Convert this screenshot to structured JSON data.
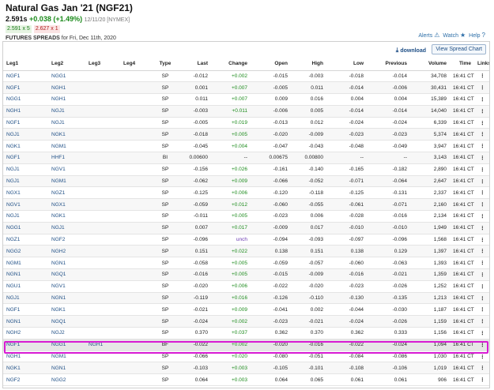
{
  "header": {
    "title": "Natural Gas Jan '21 (NGF21)",
    "last": "2.591s",
    "change": "+0.038 (+1.49%)",
    "timestamp": "12/11/20 [NYMEX]",
    "bid": "2.591 x 5",
    "ask": "2.627 x 1",
    "section": "Futures Spreads",
    "section_date": "for Fri, Dec 11th, 2020",
    "alerts_label": "Alerts",
    "watch_label": "Watch",
    "help_label": "Help"
  },
  "toolbar": {
    "download_label": "download",
    "spread_chart_label": "View Spread Chart"
  },
  "columns": [
    "Leg1",
    "Leg2",
    "Leg3",
    "Leg4",
    "Type",
    "Last",
    "Change",
    "Open",
    "High",
    "Low",
    "Previous",
    "Volume",
    "Time",
    "Links"
  ],
  "rows": [
    {
      "leg1": "NGF1",
      "leg2": "NGG1",
      "leg3": "",
      "leg4": "",
      "type": "SP",
      "last": "-0.012",
      "change": "+0.002",
      "open": "-0.015",
      "high": "-0.003",
      "low": "-0.018",
      "prev": "-0.014",
      "volume": "34,708",
      "time": "16:41 CT",
      "links": "⋮"
    },
    {
      "leg1": "NGF1",
      "leg2": "NGH1",
      "leg3": "",
      "leg4": "",
      "type": "SP",
      "last": "0.001",
      "change": "+0.007",
      "open": "-0.005",
      "high": "0.011",
      "low": "-0.014",
      "prev": "-0.006",
      "volume": "30,431",
      "time": "16:41 CT",
      "links": "⋮"
    },
    {
      "leg1": "NGG1",
      "leg2": "NGH1",
      "leg3": "",
      "leg4": "",
      "type": "SP",
      "last": "0.011",
      "change": "+0.007",
      "open": "0.009",
      "high": "0.016",
      "low": "0.004",
      "prev": "0.004",
      "volume": "15,389",
      "time": "16:41 CT",
      "links": "⋮"
    },
    {
      "leg1": "NGH1",
      "leg2": "NGJ1",
      "leg3": "",
      "leg4": "",
      "type": "SP",
      "last": "-0.003",
      "change": "+0.011",
      "open": "-0.006",
      "high": "0.005",
      "low": "-0.014",
      "prev": "-0.014",
      "volume": "14,040",
      "time": "16:41 CT",
      "links": "⋮"
    },
    {
      "leg1": "NGF1",
      "leg2": "NGJ1",
      "leg3": "",
      "leg4": "",
      "type": "SP",
      "last": "-0.005",
      "change": "+0.019",
      "open": "-0.013",
      "high": "0.012",
      "low": "-0.024",
      "prev": "-0.024",
      "volume": "6,339",
      "time": "16:41 CT",
      "links": "⋮"
    },
    {
      "leg1": "NGJ1",
      "leg2": "NGK1",
      "leg3": "",
      "leg4": "",
      "type": "SP",
      "last": "-0.018",
      "change": "+0.005",
      "open": "-0.020",
      "high": "-0.009",
      "low": "-0.023",
      "prev": "-0.023",
      "volume": "5,374",
      "time": "16:41 CT",
      "links": "⋮"
    },
    {
      "leg1": "NGK1",
      "leg2": "NGM1",
      "leg3": "",
      "leg4": "",
      "type": "SP",
      "last": "-0.045",
      "change": "+0.004",
      "open": "-0.047",
      "high": "-0.043",
      "low": "-0.048",
      "prev": "-0.049",
      "volume": "3,947",
      "time": "16:41 CT",
      "links": "⋮"
    },
    {
      "leg1": "NGF1",
      "leg2": "HHF1",
      "leg3": "",
      "leg4": "",
      "type": "BI",
      "last": "0.00600",
      "change": "--",
      "open": "0.00675",
      "high": "0.00800",
      "low": "--",
      "prev": "--",
      "volume": "3,143",
      "time": "16:41 CT",
      "links": "⋮"
    },
    {
      "leg1": "NGJ1",
      "leg2": "NGV1",
      "leg3": "",
      "leg4": "",
      "type": "SP",
      "last": "-0.156",
      "change": "+0.026",
      "open": "-0.161",
      "high": "-0.140",
      "low": "-0.165",
      "prev": "-0.182",
      "volume": "2,890",
      "time": "16:41 CT",
      "links": "⋮"
    },
    {
      "leg1": "NGJ1",
      "leg2": "NGM1",
      "leg3": "",
      "leg4": "",
      "type": "SP",
      "last": "-0.062",
      "change": "+0.009",
      "open": "-0.066",
      "high": "-0.052",
      "low": "-0.071",
      "prev": "-0.064",
      "volume": "2,647",
      "time": "16:41 CT",
      "links": "⋮"
    },
    {
      "leg1": "NGX1",
      "leg2": "NGZ1",
      "leg3": "",
      "leg4": "",
      "type": "SP",
      "last": "-0.125",
      "change": "+0.006",
      "open": "-0.120",
      "high": "-0.118",
      "low": "-0.125",
      "prev": "-0.131",
      "volume": "2,337",
      "time": "16:41 CT",
      "links": "⋮"
    },
    {
      "leg1": "NGV1",
      "leg2": "NGX1",
      "leg3": "",
      "leg4": "",
      "type": "SP",
      "last": "-0.059",
      "change": "+0.012",
      "open": "-0.060",
      "high": "-0.055",
      "low": "-0.061",
      "prev": "-0.071",
      "volume": "2,160",
      "time": "16:41 CT",
      "links": "⋮"
    },
    {
      "leg1": "NGJ1",
      "leg2": "NGK1",
      "leg3": "",
      "leg4": "",
      "type": "SP",
      "last": "-0.011",
      "change": "+0.005",
      "open": "-0.023",
      "high": "0.006",
      "low": "-0.028",
      "prev": "-0.016",
      "volume": "2,134",
      "time": "16:41 CT",
      "links": "⋮"
    },
    {
      "leg1": "NGG1",
      "leg2": "NGJ1",
      "leg3": "",
      "leg4": "",
      "type": "SP",
      "last": "0.007",
      "change": "+0.017",
      "open": "-0.009",
      "high": "0.017",
      "low": "-0.010",
      "prev": "-0.010",
      "volume": "1,949",
      "time": "16:41 CT",
      "links": "⋮"
    },
    {
      "leg1": "NGZ1",
      "leg2": "NGF2",
      "leg3": "",
      "leg4": "",
      "type": "SP",
      "last": "-0.096",
      "change": "unch",
      "open": "-0.094",
      "high": "-0.093",
      "low": "-0.097",
      "prev": "-0.096",
      "volume": "1,568",
      "time": "16:41 CT",
      "links": "⋮"
    },
    {
      "leg1": "NGG2",
      "leg2": "NGH2",
      "leg3": "",
      "leg4": "",
      "type": "SP",
      "last": "0.151",
      "change": "+0.022",
      "open": "0.138",
      "high": "0.151",
      "low": "0.138",
      "prev": "0.129",
      "volume": "1,397",
      "time": "16:41 CT",
      "links": "⋮"
    },
    {
      "leg1": "NGM1",
      "leg2": "NGN1",
      "leg3": "",
      "leg4": "",
      "type": "SP",
      "last": "-0.058",
      "change": "+0.005",
      "open": "-0.059",
      "high": "-0.057",
      "low": "-0.060",
      "prev": "-0.063",
      "volume": "1,393",
      "time": "16:41 CT",
      "links": "⋮"
    },
    {
      "leg1": "NGN1",
      "leg2": "NGQ1",
      "leg3": "",
      "leg4": "",
      "type": "SP",
      "last": "-0.016",
      "change": "+0.005",
      "open": "-0.015",
      "high": "-0.009",
      "low": "-0.016",
      "prev": "-0.021",
      "volume": "1,359",
      "time": "16:41 CT",
      "links": "⋮"
    },
    {
      "leg1": "NGU1",
      "leg2": "NGV1",
      "leg3": "",
      "leg4": "",
      "type": "SP",
      "last": "-0.020",
      "change": "+0.006",
      "open": "-0.022",
      "high": "-0.020",
      "low": "-0.023",
      "prev": "-0.026",
      "volume": "1,252",
      "time": "16:41 CT",
      "links": "⋮"
    },
    {
      "leg1": "NGJ1",
      "leg2": "NGN1",
      "leg3": "",
      "leg4": "",
      "type": "SP",
      "last": "-0.119",
      "change": "+0.016",
      "open": "-0.126",
      "high": "-0.110",
      "low": "-0.130",
      "prev": "-0.135",
      "volume": "1,213",
      "time": "16:41 CT",
      "links": "⋮"
    },
    {
      "leg1": "NGF1",
      "leg2": "NGK1",
      "leg3": "",
      "leg4": "",
      "type": "SP",
      "last": "-0.021",
      "change": "+0.009",
      "open": "-0.041",
      "high": "0.002",
      "low": "-0.044",
      "prev": "-0.030",
      "volume": "1,187",
      "time": "16:41 CT",
      "links": "⋮"
    },
    {
      "leg1": "NGN1",
      "leg2": "NGQ1",
      "leg3": "",
      "leg4": "",
      "type": "SP",
      "last": "-0.024",
      "change": "+0.002",
      "open": "-0.023",
      "high": "-0.021",
      "low": "-0.024",
      "prev": "-0.026",
      "volume": "1,159",
      "time": "16:41 CT",
      "links": "⋮"
    },
    {
      "leg1": "NGH2",
      "leg2": "NGJ2",
      "leg3": "",
      "leg4": "",
      "type": "SP",
      "last": "0.370",
      "change": "+0.037",
      "open": "0.362",
      "high": "0.370",
      "low": "0.362",
      "prev": "0.333",
      "volume": "1,156",
      "time": "16:41 CT",
      "links": "⋮"
    },
    {
      "leg1": "NGF1",
      "leg2": "NGG1",
      "leg3": "NGH1",
      "leg4": "",
      "type": "BF",
      "last": "-0.022",
      "change": "+0.002",
      "open": "-0.020",
      "high": "-0.016",
      "low": "-0.022",
      "prev": "-0.024",
      "volume": "1,094",
      "time": "16:41 CT",
      "links": "⋮"
    },
    {
      "leg1": "NGH1",
      "leg2": "NGM1",
      "leg3": "",
      "leg4": "",
      "type": "SP",
      "last": "-0.066",
      "change": "+0.020",
      "open": "-0.080",
      "high": "-0.051",
      "low": "-0.084",
      "prev": "-0.086",
      "volume": "1,030",
      "time": "16:41 CT",
      "links": "⋮"
    },
    {
      "leg1": "NGK1",
      "leg2": "NGN1",
      "leg3": "",
      "leg4": "",
      "type": "SP",
      "last": "-0.103",
      "change": "+0.003",
      "open": "-0.105",
      "high": "-0.101",
      "low": "-0.108",
      "prev": "-0.106",
      "volume": "1,019",
      "time": "16:41 CT",
      "links": "⋮"
    },
    {
      "leg1": "NGF2",
      "leg2": "NGG2",
      "leg3": "",
      "leg4": "",
      "type": "SP",
      "last": "0.064",
      "change": "+0.003",
      "open": "0.064",
      "high": "0.065",
      "low": "0.061",
      "prev": "0.061",
      "volume": "906",
      "time": "16:41 CT",
      "links": "⋮"
    }
  ],
  "highlighted_row_index": 23,
  "colors": {
    "positive": "#1a8a1a",
    "unchanged": "#6a3ab2",
    "link": "#1f4f86",
    "highlight_border": "#d81bd3"
  }
}
